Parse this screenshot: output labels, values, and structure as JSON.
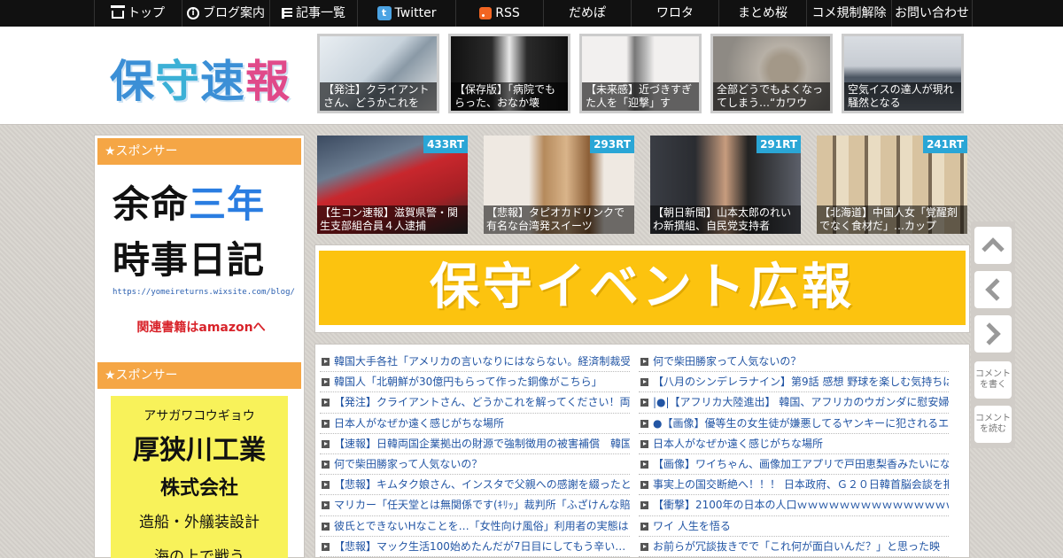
{
  "nav": [
    {
      "label": "トップ",
      "icon": "home-icon"
    },
    {
      "label": "ブログ案内",
      "icon": "info-icon"
    },
    {
      "label": "記事一覧",
      "icon": "list-icon"
    },
    {
      "label": "Twitter",
      "icon": "twitter-icon"
    },
    {
      "label": "RSS",
      "icon": "rss-icon"
    },
    {
      "label": "だめぽ"
    },
    {
      "label": "ワロタ"
    },
    {
      "label": "まとめ桜"
    },
    {
      "label": "コメ規制解除"
    },
    {
      "label": "お問い合わせ"
    }
  ],
  "logo": {
    "chars": [
      "保",
      "守",
      "速",
      "報"
    ]
  },
  "header_thumbs": [
    "【発注】クライアントさん、どうかこれを",
    "【保存版】「病院でもらった、おなか壊",
    "【未来感】近づきすぎた人を「迎撃」す",
    "全部どうでもよくなってしまう…“カワウ",
    "空気イスの達人が現れ騒然となる"
  ],
  "sidebar": {
    "sponsor_label": "★スポンサー",
    "ad1": {
      "line1_a": "余命",
      "line1_b": "三年",
      "line2": "時事日記",
      "url": "https://yomeireturns.wixsite.com/blog/",
      "amazon": "関連書籍はamazonへ"
    },
    "ad2": {
      "kana": "アサガワコウギョウ",
      "name": "厚狭川工業",
      "corp": "株式会社",
      "biz": "造船・外艤装設計",
      "more": "海の上で戦う"
    }
  },
  "ranking": [
    {
      "rt": "433RT",
      "caption": "【生コン速報】滋賀県警・関生支部組合員４人逮捕"
    },
    {
      "rt": "293RT",
      "caption": "【悲報】タピオカドリンクで有名な台湾発スイーツ"
    },
    {
      "rt": "291RT",
      "caption": "【朝日新聞】山本太郎のれいわ新撰組、自民党支持者"
    },
    {
      "rt": "241RT",
      "caption": "【北海道】中国人女「覚醒剤でなく食材だ」…カップ"
    }
  ],
  "banner": {
    "text": "保守イベント広報"
  },
  "articles_left": [
    "韓国大手各社「アメリカの言いなりにはならない。経済制裁受",
    "韓国人「北朝鮮が30億円もらって作った銅像がこちら」",
    "【発注】クライアントさん、どうかこれを解ってください！両",
    "日本人がなぜか遠く感じがちな場所",
    "【速報】日韓両国企業拠出の財源で強制徴用の被害補償　韓国",
    "何で柴田勝家って人気ないの？",
    "【悲報】キムタク娘さん、インスタで父親への感謝を綴ったと",
    "マリカー「任天堂とは無関係です(ｷﾘｯ」裁判所「ふざけんな賠",
    "彼氏とできないHなことを…「女性向け風俗」利用者の実態は",
    "【悲報】マック生活100始めたんだが7日目にしてもう辛い…"
  ],
  "articles_right": [
    "何で柴田勝家って人気ないの？",
    "【八月のシンデレラナイン】第9話 感想 野球を楽しむ気持ちは",
    "|●|【アフリカ大陸進出】 韓国、アフリカのウガンダに慰安婦の",
    "●【画像】優等生の女生徒が嫌悪してるヤンキーに犯されるエ●",
    "日本人がなぜか遠く感じがちな場所",
    "【画像】ワイちゃん、画像加工アプリで戸田恵梨香みたいにな",
    "事実上の国交断絶へ！！！ 日本政府、Ｇ２０日韓首脳会談を拒",
    "【衝撃】2100年の日本の人口ｗｗｗｗｗｗｗｗｗｗｗｗｗｗｗ",
    "ワイ 人生を悟る",
    "お前らが冗談抜きでで「これ何が面白いんだ？」と思った映"
  ],
  "float_nav": {
    "write_comment": "コメントを書く",
    "read_comment": "コメントを読む"
  },
  "colors": {
    "nav_bg": "#111111",
    "sponsor": "#f5a645",
    "banner": "#fcc30f",
    "rt_badge": "#2aa6d6",
    "link": "#2255a4"
  }
}
